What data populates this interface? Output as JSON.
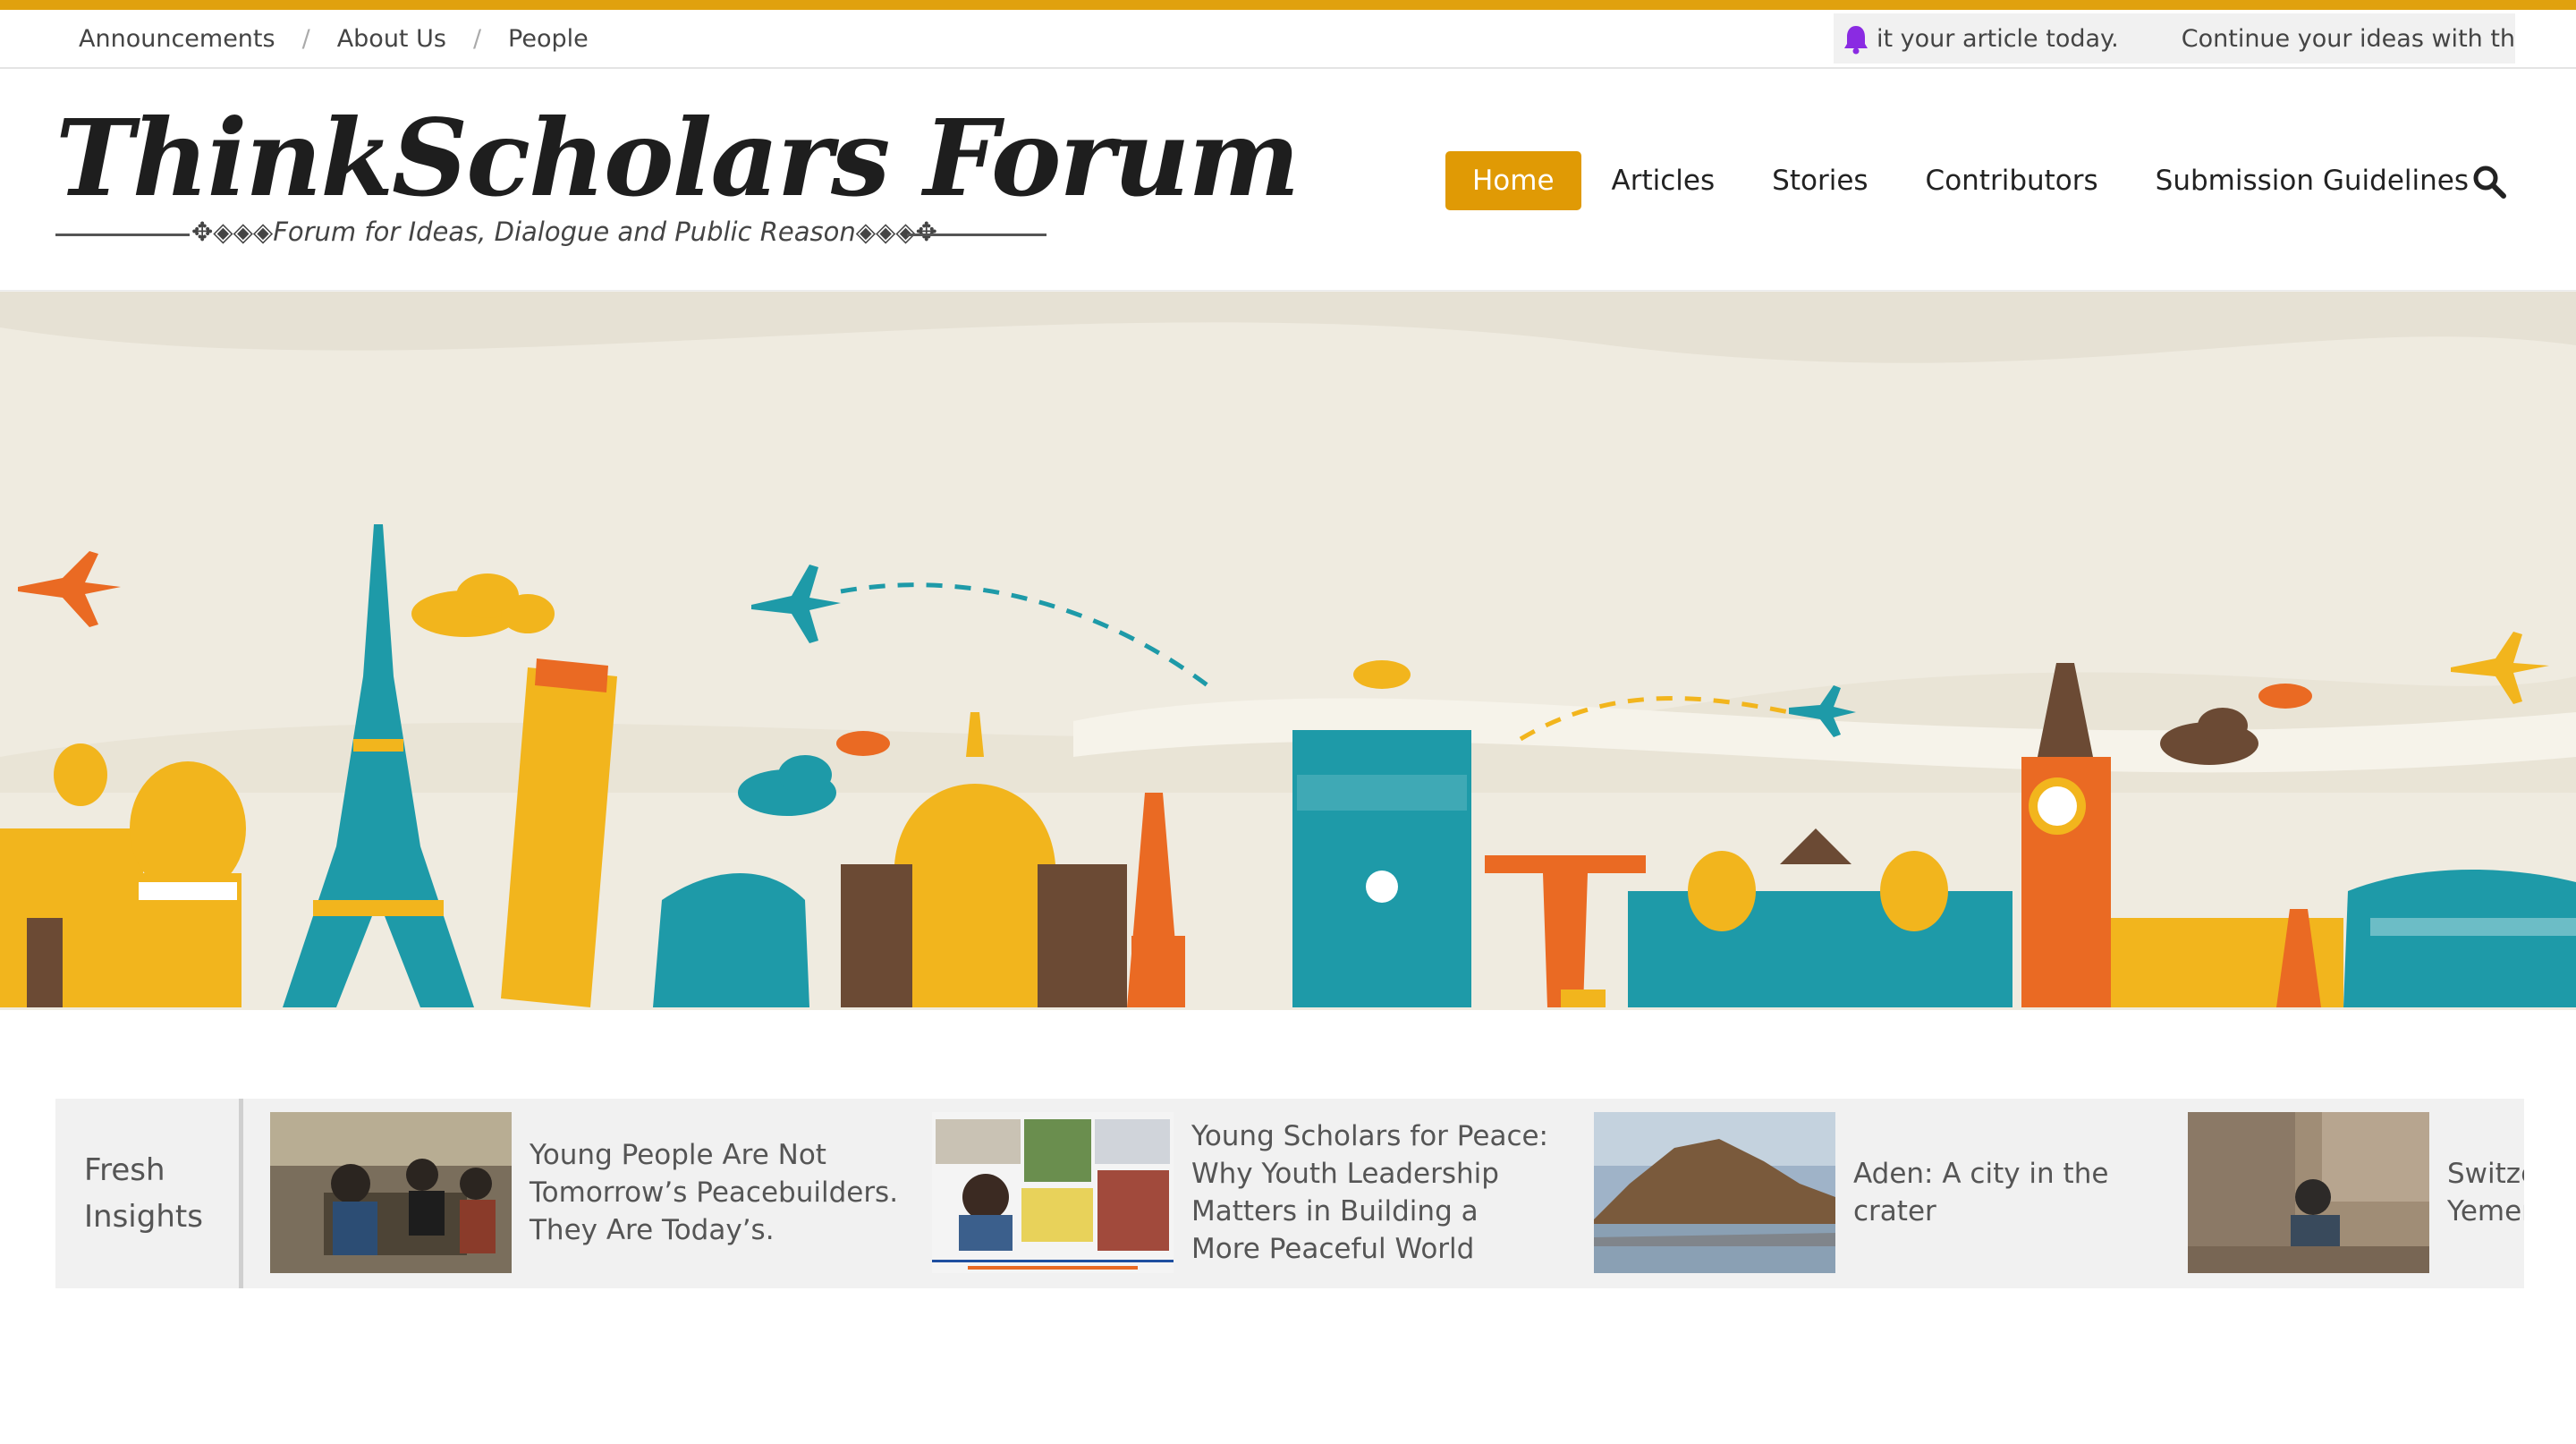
{
  "topbar": {
    "links": [
      "Announcements",
      "About Us",
      "People"
    ],
    "ticker": [
      "it your article today.",
      "Continue your ideas with the wo"
    ]
  },
  "header": {
    "logo_title": "ThinkScholars Forum",
    "logo_tagline": "✥◈◈◈Forum for Ideas, Dialogue and Public Reason◈◈◈✥",
    "nav": [
      "Home",
      "Articles",
      "Stories",
      "Contributors",
      "Submission Guidelines"
    ],
    "active_nav": "Home"
  },
  "insights": {
    "label_line1": "Fresh",
    "label_line2": "Insights",
    "items": [
      {
        "title": "Young People Are Not Tomorrow’s Peacebuilders. They Are Today’s."
      },
      {
        "title": "Young Scholars for Peace: Why Youth Leadership Matters in Building a More Peaceful World"
      },
      {
        "title": "Aden: A city in the crater"
      },
      {
        "title": "Switzerland Yemen"
      }
    ]
  },
  "colors": {
    "accent": "#e09a05",
    "topline": "#e0a10e",
    "bell": "#8a2be2",
    "hero_bg": "#efebe0",
    "teal": "#1e9aa8",
    "orange": "#ea6a23",
    "yellow": "#f2b51d",
    "brown": "#6b4a34"
  },
  "icons": [
    "bell-icon",
    "search-icon"
  ]
}
